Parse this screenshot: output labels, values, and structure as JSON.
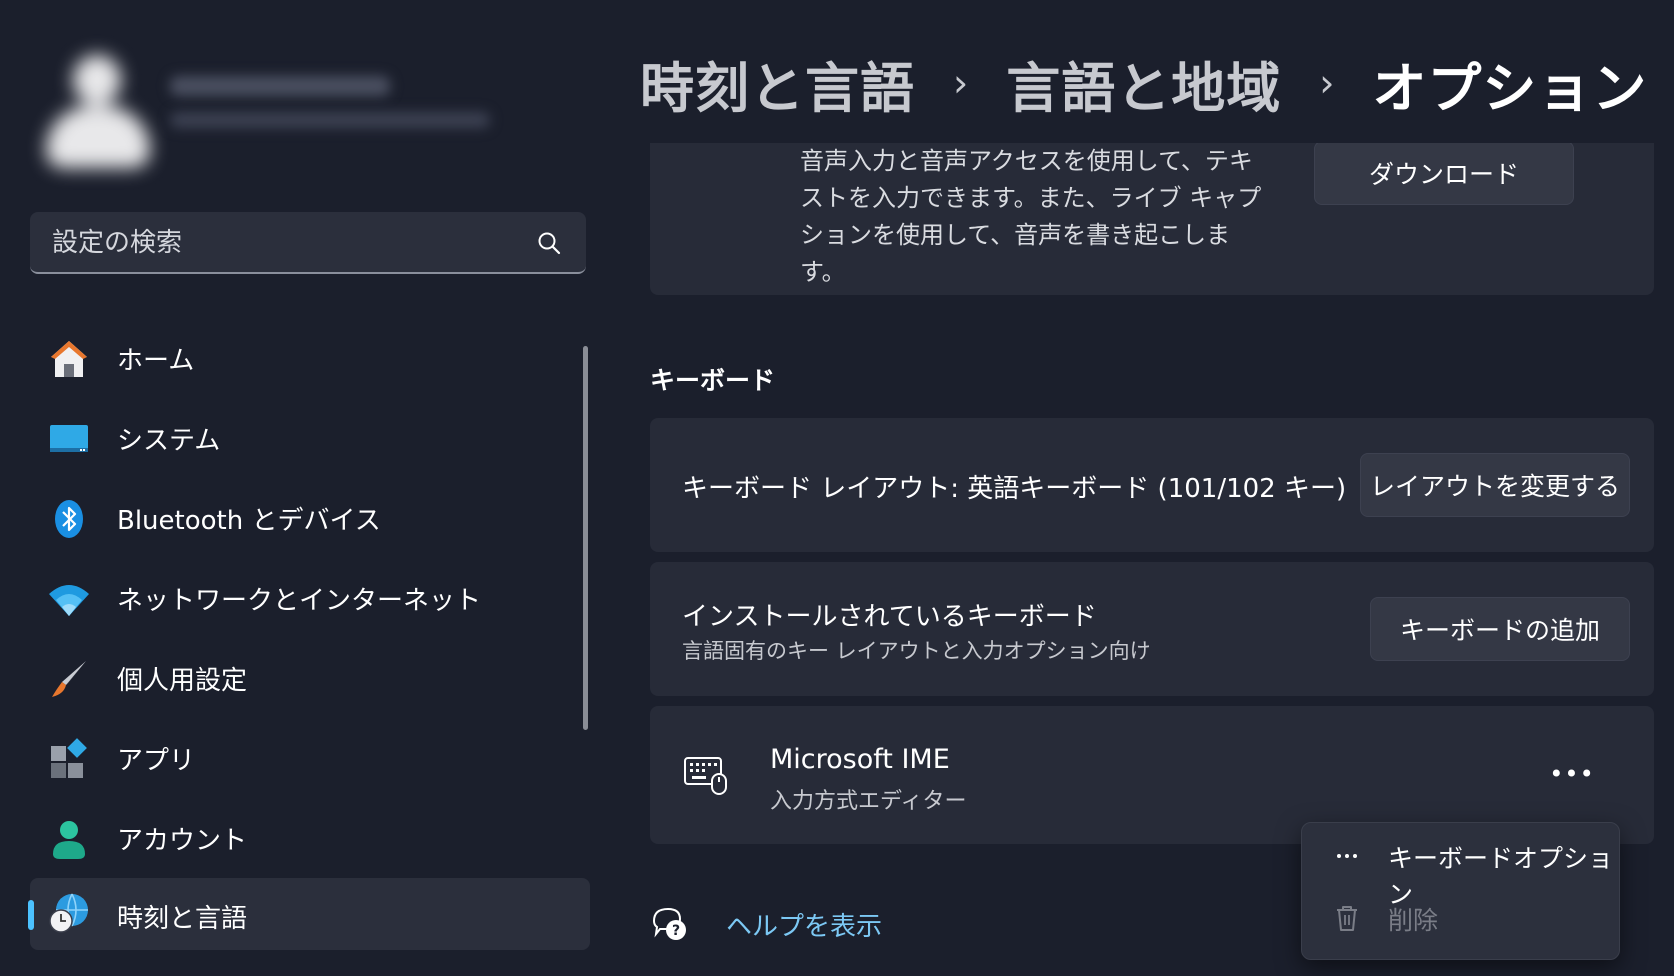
{
  "sidebar": {
    "search": {
      "placeholder": "設定の検索"
    },
    "items": [
      {
        "label": "ホーム"
      },
      {
        "label": "システム"
      },
      {
        "label": "Bluetooth とデバイス"
      },
      {
        "label": "ネットワークとインターネット"
      },
      {
        "label": "個人用設定"
      },
      {
        "label": "アプリ"
      },
      {
        "label": "アカウント"
      },
      {
        "label": "時刻と言語",
        "active": true
      }
    ]
  },
  "header": {
    "breadcrumb": [
      "時刻と言語",
      "言語と地域",
      "オプション"
    ],
    "separator": "›"
  },
  "speech": {
    "description": "音声入力と音声アクセスを使用して、テキストを入力できます。また、ライブ キャプションを使用して、音声を書き起こします。",
    "download_label": "ダウンロード"
  },
  "keyboard_section": {
    "title": "キーボード",
    "layout_text": "キーボード レイアウト: 英語キーボード (101/102 キー)",
    "change_layout_label": "レイアウトを変更する",
    "installed_title": "インストールされているキーボード",
    "installed_subtitle": "言語固有のキー レイアウトと入力オプション向け",
    "add_keyboard_label": "キーボードの追加",
    "ime_name": "Microsoft IME",
    "ime_desc": "入力方式エディター",
    "more_label": "•••"
  },
  "help": {
    "label": "ヘルプを表示"
  },
  "context_menu": {
    "items": [
      {
        "label": "キーボードオプション",
        "icon": "more-icon",
        "enabled": true
      },
      {
        "label": "削除",
        "icon": "trash-icon",
        "enabled": false
      }
    ]
  },
  "colors": {
    "accent": "#4cc2ff",
    "link": "#7cc8f4",
    "background": "#1b1f2c",
    "card": "#272b38"
  }
}
